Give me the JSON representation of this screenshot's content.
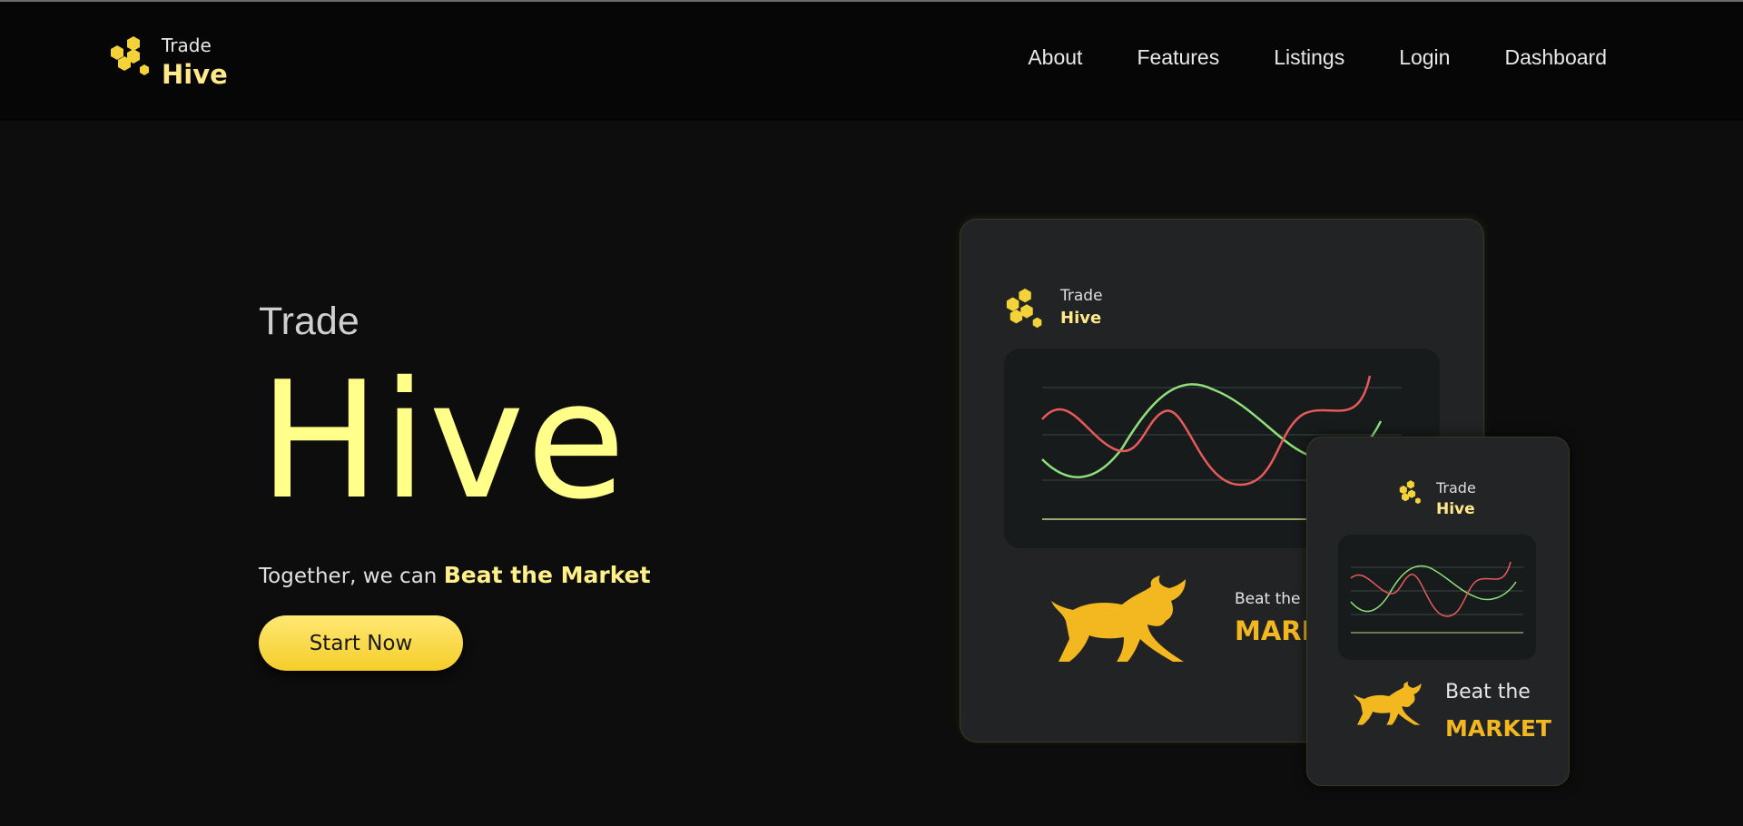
{
  "header": {
    "logo_small": "Trade",
    "logo_big": "Hive",
    "nav": [
      "About",
      "Features",
      "Listings",
      "Login",
      "Dashboard"
    ]
  },
  "hero": {
    "small": "Trade",
    "big": "Hive",
    "tagline_prefix": "Together, we can ",
    "tagline_bold": "Beat the Market",
    "cta": "Start Now"
  },
  "card_big": {
    "logo_small": "Trade",
    "logo_big": "Hive",
    "beat": "Beat the",
    "market": "MARKET"
  },
  "card_small": {
    "logo_small": "Trade",
    "logo_big": "Hive",
    "beat": "Beat the",
    "market": "MARKET"
  },
  "colors": {
    "accent": "#ffff8a",
    "gold": "#f3b71f",
    "line_red": "#e85a5a",
    "line_green": "#8fe07a"
  }
}
